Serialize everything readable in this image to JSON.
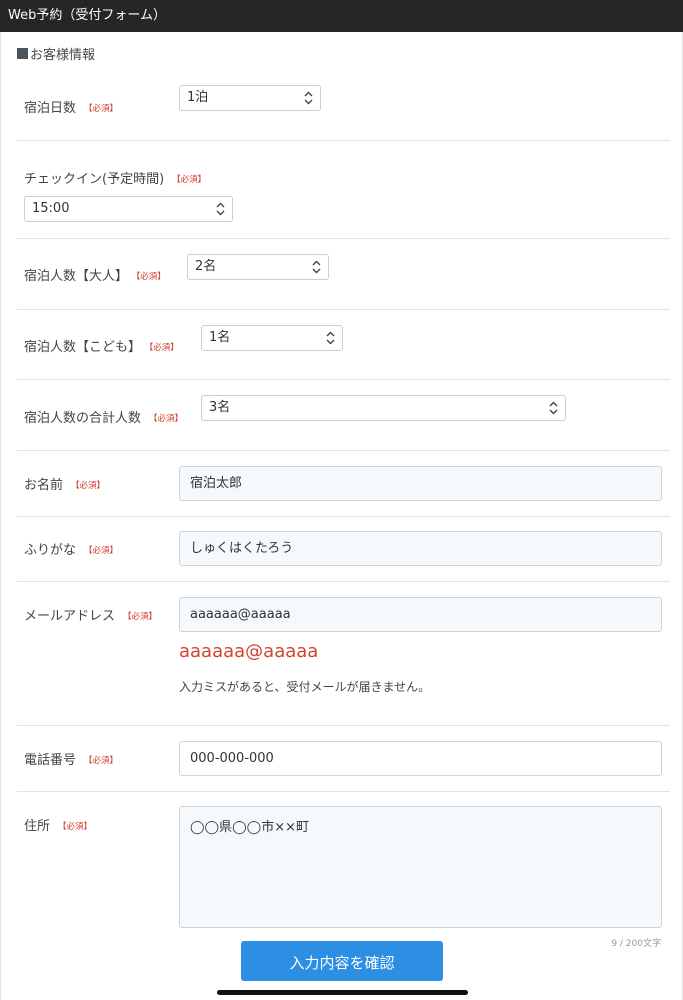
{
  "window": {
    "title": "Web予約（受付フォーム）"
  },
  "form": {
    "section_title": "お客様情報",
    "required_mark": "【必須】",
    "nights": {
      "label": "宿泊日数",
      "value": "1泊"
    },
    "checkin": {
      "label": "チェックイン(予定時間)",
      "value": "15:00"
    },
    "adults": {
      "label": "宿泊人数【大人】",
      "value": "2名"
    },
    "children": {
      "label": "宿泊人数【こども】",
      "value": "1名"
    },
    "total": {
      "label": "宿泊人数の合計人数",
      "value": "3名"
    },
    "name": {
      "label": "お名前",
      "value": "宿泊太郎"
    },
    "furigana": {
      "label": "ふりがな",
      "value": "しゅくはくたろう"
    },
    "email": {
      "label": "メールアドレス",
      "value": "aaaaaa@aaaaa",
      "echo": "aaaaaa@aaaaa",
      "note": "入力ミスがあると、受付メールが届きません。"
    },
    "phone": {
      "label": "電話番号",
      "value": "000-000-000"
    },
    "address": {
      "label": "住所",
      "value": "◯◯県◯◯市××町",
      "counter": "9 / 200文字"
    },
    "submit_label": "入力内容を確認"
  },
  "icons": {
    "select_arrow": "chevron-updown-icon"
  }
}
